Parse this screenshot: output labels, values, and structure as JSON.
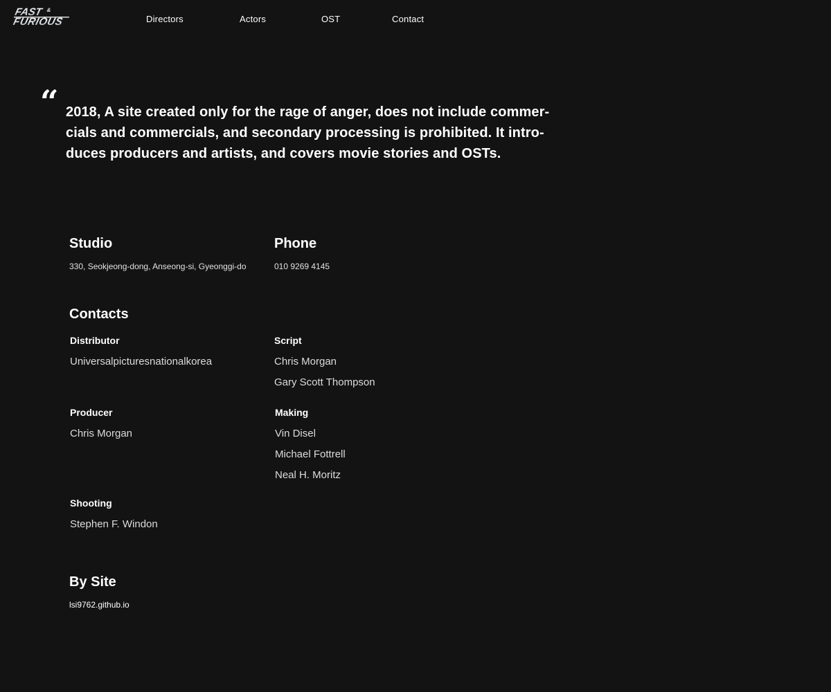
{
  "brand": {
    "logo_text_top": "FAST",
    "logo_amp": "&",
    "logo_text_bottom": "FURIOUS"
  },
  "nav": {
    "items": [
      {
        "label": "Directors"
      },
      {
        "label": "Actors"
      },
      {
        "label": "OST"
      },
      {
        "label": "Contact"
      }
    ]
  },
  "quote": {
    "mark": "“",
    "text": "2018, A site created only for the rage of anger, does not include commer-cials and commercials, and secondary processing is prohibited. It intro-duces producers and artists, and covers movie stories and OSTs."
  },
  "studio": {
    "heading": "Studio",
    "address": "330, Seokjeong-dong, Anseong-si, Gyeonggi-do"
  },
  "phone": {
    "heading": "Phone",
    "number": "010 9269 4145"
  },
  "contacts": {
    "heading": "Contacts",
    "groups": [
      {
        "title": "Distributor",
        "names": [
          "Universalpicturesnationalkorea"
        ]
      },
      {
        "title": "Script",
        "names": [
          "Chris Morgan",
          "Gary Scott Thompson"
        ]
      },
      {
        "title": "Producer",
        "names": [
          "Chris Morgan"
        ]
      },
      {
        "title": "Making",
        "names": [
          "Vin Disel",
          "Michael Fottrell",
          "Neal H. Moritz"
        ]
      },
      {
        "title": "Shooting",
        "names": [
          "Stephen F. Windon"
        ]
      }
    ]
  },
  "by_site": {
    "heading": "By Site",
    "link": "lsi9762.github.io"
  },
  "colors": {
    "background": "#131313",
    "text": "#ffffff",
    "muted_text": "#dcdcdc"
  }
}
